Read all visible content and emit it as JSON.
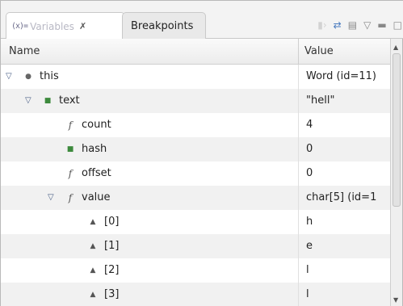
{
  "tabs": {
    "variables_label": "Variables",
    "variables_icon": "(x)=",
    "variables_close": "✗",
    "breakpoints_label": "Breakpoints"
  },
  "toolbar": {
    "icons": [
      "skip-icon",
      "collapse-all-icon",
      "layout-icon",
      "view-menu-icon",
      "minimize-icon",
      "maximize-icon"
    ]
  },
  "columns": {
    "name": "Name",
    "value": "Value"
  },
  "rows": [
    {
      "name": "this",
      "value": "Word  (id=11)",
      "icon": "object-icon",
      "twisty": "expanded",
      "indent": 0
    },
    {
      "name": "text",
      "value": "\"hell\"",
      "icon": "field-icon",
      "twisty": "expanded",
      "indent": 1
    },
    {
      "name": "count",
      "value": "4",
      "icon": "final-field-icon",
      "twisty": "none",
      "indent": 2
    },
    {
      "name": "hash",
      "value": "0",
      "icon": "field-icon",
      "twisty": "none",
      "indent": 2
    },
    {
      "name": "offset",
      "value": "0",
      "icon": "final-field-icon",
      "twisty": "none",
      "indent": 2
    },
    {
      "name": "value",
      "value": "char[5]  (id=1",
      "icon": "final-field-icon",
      "twisty": "expanded",
      "indent": 2
    },
    {
      "name": "[0]",
      "value": "h",
      "icon": "array-element-icon",
      "twisty": "none",
      "indent": 3
    },
    {
      "name": "[1]",
      "value": "e",
      "icon": "array-element-icon",
      "twisty": "none",
      "indent": 3
    },
    {
      "name": "[2]",
      "value": "l",
      "icon": "array-element-icon",
      "twisty": "none",
      "indent": 3
    },
    {
      "name": "[3]",
      "value": "l",
      "icon": "array-element-icon",
      "twisty": "none",
      "indent": 3
    }
  ],
  "colors": {
    "tab_bar_bg": "#f3f3f3",
    "header_bg": "#ececec",
    "alt_row_bg": "#f1f1f1",
    "field_icon": "#3d8a3d"
  }
}
